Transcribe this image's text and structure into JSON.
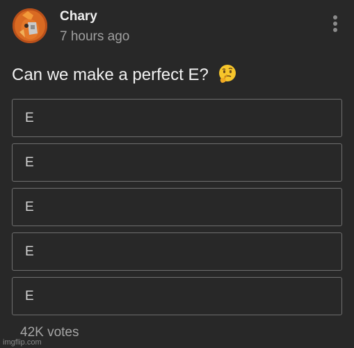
{
  "post": {
    "author": "Chary",
    "timestamp": "7 hours ago",
    "question": "Can we make a perfect E?",
    "question_emoji_icon": "thinking-face-icon",
    "menu_icon": "more-vertical-icon",
    "avatar_icon": "orange-character-avatar"
  },
  "poll": {
    "options": [
      "E",
      "E",
      "E",
      "E",
      "E"
    ],
    "votes": "42K votes"
  },
  "watermark": "imgflip.com",
  "colors": {
    "background": "#282828",
    "text_primary": "#f2f2f2",
    "text_secondary": "#a0a0a0",
    "option_border": "#6f6f6f"
  }
}
